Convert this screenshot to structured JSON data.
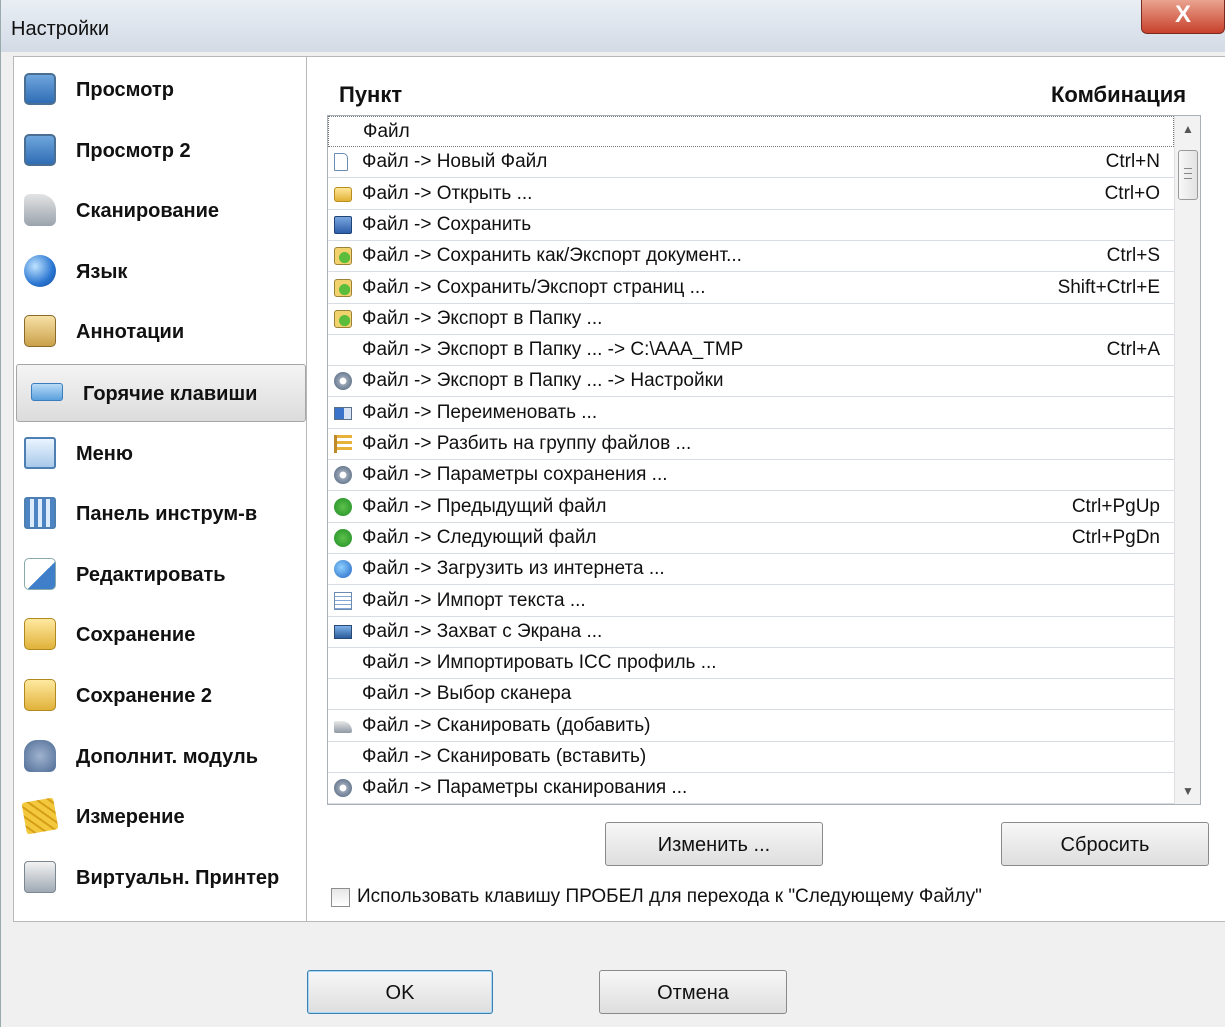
{
  "window": {
    "title": "Настройки",
    "close_label": "X"
  },
  "sidebar": {
    "items": [
      {
        "label": "Просмотр",
        "icon": "monitor-icon",
        "selected": false
      },
      {
        "label": "Просмотр 2",
        "icon": "monitor-icon",
        "selected": false
      },
      {
        "label": "Сканирование",
        "icon": "scanner-icon",
        "selected": false
      },
      {
        "label": "Язык",
        "icon": "globe-icon",
        "selected": false
      },
      {
        "label": "Аннотации",
        "icon": "annotation-icon",
        "selected": false
      },
      {
        "label": "Горячие клавиши",
        "icon": "keyboard-icon",
        "selected": true
      },
      {
        "label": "Меню",
        "icon": "menu-icon",
        "selected": false
      },
      {
        "label": "Панель инструм-в",
        "icon": "toolbar-icon",
        "selected": false
      },
      {
        "label": "Редактировать",
        "icon": "edit-icon",
        "selected": false
      },
      {
        "label": "Сохранение",
        "icon": "save-folder-icon",
        "selected": false
      },
      {
        "label": "Сохранение 2",
        "icon": "save-folder-icon",
        "selected": false
      },
      {
        "label": "Дополнит. модуль",
        "icon": "plugin-icon",
        "selected": false
      },
      {
        "label": "Измерение",
        "icon": "ruler-icon",
        "selected": false
      },
      {
        "label": "Виртуальн. Принтер",
        "icon": "printer-icon",
        "selected": false
      }
    ]
  },
  "hotkeys": {
    "col_item": "Пункт",
    "col_combo": "Комбинация",
    "rows": [
      {
        "label": "Файл",
        "hotkey": "",
        "icon": ""
      },
      {
        "label": "Файл -> Новый Файл",
        "hotkey": "Ctrl+N",
        "icon": "new-file-icon"
      },
      {
        "label": "Файл -> Открыть ...",
        "hotkey": "Ctrl+O",
        "icon": "open-folder-icon"
      },
      {
        "label": "Файл -> Сохранить",
        "hotkey": "",
        "icon": "floppy-icon"
      },
      {
        "label": "Файл -> Сохранить как/Экспорт документ...",
        "hotkey": "Ctrl+S",
        "icon": "export-icon"
      },
      {
        "label": "Файл -> Сохранить/Экспорт страниц ...",
        "hotkey": "Shift+Ctrl+E",
        "icon": "export-icon"
      },
      {
        "label": "Файл -> Экспорт в Папку ...",
        "hotkey": "",
        "icon": "export-icon"
      },
      {
        "label": "Файл -> Экспорт в Папку ... -> C:\\AAA_TMP",
        "hotkey": "Ctrl+A",
        "icon": ""
      },
      {
        "label": "Файл -> Экспорт в Папку ... -> Настройки",
        "hotkey": "",
        "icon": "gear-icon"
      },
      {
        "label": "Файл -> Переименовать ...",
        "hotkey": "",
        "icon": "rename-icon"
      },
      {
        "label": "Файл -> Разбить на группу файлов ...",
        "hotkey": "",
        "icon": "split-icon"
      },
      {
        "label": "Файл -> Параметры сохранения ...",
        "hotkey": "",
        "icon": "gear-icon"
      },
      {
        "label": "Файл -> Предыдущий файл",
        "hotkey": "Ctrl+PgUp",
        "icon": "arrow-left-icon"
      },
      {
        "label": "Файл -> Следующий файл",
        "hotkey": "Ctrl+PgDn",
        "icon": "arrow-right-icon"
      },
      {
        "label": "Файл -> Загрузить из интернета ...",
        "hotkey": "",
        "icon": "internet-icon"
      },
      {
        "label": "Файл -> Импорт текста ...",
        "hotkey": "",
        "icon": "text-file-icon"
      },
      {
        "label": "Файл -> Захват с Экрана ...",
        "hotkey": "",
        "icon": "screen-capture-icon"
      },
      {
        "label": "Файл -> Импортировать ICC профиль ...",
        "hotkey": "",
        "icon": ""
      },
      {
        "label": "Файл -> Выбор сканера",
        "hotkey": "",
        "icon": ""
      },
      {
        "label": "Файл -> Сканировать (добавить)",
        "hotkey": "",
        "icon": "scanner-icon"
      },
      {
        "label": "Файл -> Сканировать (вставить)",
        "hotkey": "",
        "icon": ""
      },
      {
        "label": "Файл -> Параметры сканирования ...",
        "hotkey": "",
        "icon": "gear-icon"
      }
    ]
  },
  "buttons": {
    "change": "Изменить ...",
    "reset": "Сбросить",
    "ok": "OK",
    "cancel": "Отмена"
  },
  "option": {
    "label": "Использовать клавишу ПРОБЕЛ для перехода к \"Следующему Файлу\"",
    "checked": false
  }
}
